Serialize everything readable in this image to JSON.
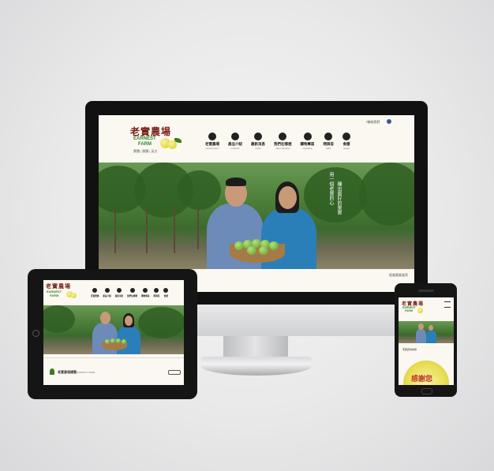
{
  "site": {
    "logo_zh": "老實農場",
    "logo_en_1": "EARNEST",
    "logo_en_2": "FARM",
    "logo_sub": "繁體 | 簡體 | 英文",
    "top_link": "+聯絡我們",
    "tagline_1": "用一個老實的心",
    "tagline_2": "種出最好的果實",
    "footer_note": "經營農業當然"
  },
  "nav": [
    {
      "zh": "老實農場",
      "en": "earnest farm",
      "icon": "flower-icon"
    },
    {
      "zh": "產品介紹",
      "en": "products",
      "icon": "lemon-slice-icon"
    },
    {
      "zh": "最新消息",
      "en": "news",
      "icon": "farmer-icon"
    },
    {
      "zh": "我們在哪裡",
      "en": "sales channel",
      "icon": "store-icon"
    },
    {
      "zh": "購物專區",
      "en": "shopping",
      "icon": "basket-icon"
    },
    {
      "zh": "問與答",
      "en": "Q&A",
      "icon": "chat-icon"
    },
    {
      "zh": "食譜",
      "en": "recipe",
      "icon": "plate-icon"
    }
  ],
  "tablet": {
    "section_title": "老實農場總覽",
    "section_sub": "EARNEST FARM"
  },
  "phone": {
    "promo_text": "感謝您"
  },
  "colors": {
    "background": "#e9e9ea",
    "brand_red": "#7a1f16",
    "brand_green": "#2f8a2a",
    "lemon": "#d6cf25"
  }
}
